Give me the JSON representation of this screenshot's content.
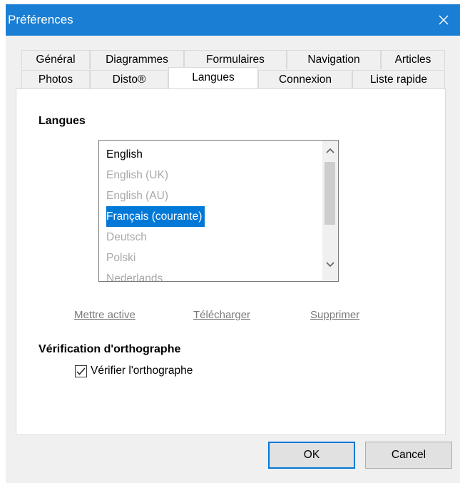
{
  "window": {
    "title": "Préférences",
    "close_symbol": "✕",
    "titlebar_color": "#1a7fd4"
  },
  "tabs": {
    "row_back": [
      {
        "label": "Général"
      },
      {
        "label": "Diagrammes"
      },
      {
        "label": "Formulaires"
      },
      {
        "label": "Navigation"
      },
      {
        "label": "Articles"
      }
    ],
    "row_front": [
      {
        "label": "Photos"
      },
      {
        "label": "Disto®"
      },
      {
        "label": "Langues",
        "active": true
      },
      {
        "label": "Connexion"
      },
      {
        "label": "Liste rapide"
      }
    ]
  },
  "languages_section": {
    "title": "Langues",
    "items": [
      {
        "label": "English",
        "state": "enabled"
      },
      {
        "label": "English (UK)",
        "state": "disabled"
      },
      {
        "label": "English (AU)",
        "state": "disabled"
      },
      {
        "label": "Français (courante)",
        "state": "selected"
      },
      {
        "label": "Deutsch",
        "state": "disabled"
      },
      {
        "label": "Polski",
        "state": "disabled"
      },
      {
        "label": "Nederlands",
        "state": "disabled-partial"
      }
    ],
    "scroll_up_icon": "chevron-up",
    "scroll_down_icon": "chevron-down"
  },
  "actions": {
    "set_active": "Mettre active",
    "download": "Télécharger",
    "delete": "Supprimer"
  },
  "spellcheck_section": {
    "title": "Vérification d'orthographe",
    "checkbox_label": "Vérifier l'orthographe",
    "checked": true
  },
  "footer": {
    "ok": "OK",
    "cancel": "Cancel"
  },
  "colors": {
    "selection": "#0078d7",
    "disabled_text": "#a8a8a8",
    "link_disabled": "#7a7a7a"
  }
}
